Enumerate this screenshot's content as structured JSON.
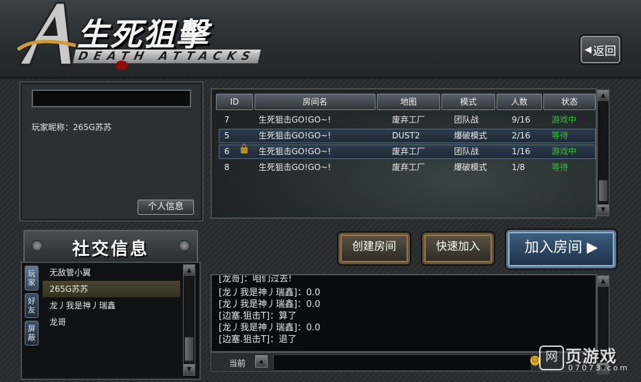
{
  "header": {
    "title": "生死狙擊",
    "subtitle": "DEATH ATTACKS",
    "back_label": "返回",
    "back_arrow": "◀"
  },
  "profile": {
    "player_label": "玩家昵称：265G苏苏",
    "info_button": "个人信息"
  },
  "social": {
    "title": "社交信息",
    "tabs": [
      "玩家",
      "好友",
      "屏蔽"
    ],
    "friends": [
      "无敌管小翼",
      "265G苏苏",
      "龙丿我是神丿瑞鑫",
      "龙哥"
    ],
    "selected_index": 1
  },
  "rooms": {
    "columns": [
      "ID",
      "房间名",
      "地图",
      "模式",
      "人数",
      "状态"
    ],
    "rows": [
      {
        "id": "7",
        "name": "生死狙击GO!GO~!",
        "map": "废弃工厂",
        "mode": "团队战",
        "players": "9/16",
        "status": "游戏中",
        "locked": false,
        "highlight": false,
        "status_color": "#36c23a"
      },
      {
        "id": "5",
        "name": "生死狙击GO!GO~!",
        "map": "DUST2",
        "mode": "爆破模式",
        "players": "2/16",
        "status": "等待",
        "locked": false,
        "highlight": true,
        "status_color": "#36c23a"
      },
      {
        "id": "6",
        "name": "生死狙击GO!GO~!",
        "map": "废弃工厂",
        "mode": "团队战",
        "players": "1/16",
        "status": "游戏中",
        "locked": true,
        "highlight": true,
        "status_color": "#36c23a"
      },
      {
        "id": "8",
        "name": "生死狙击GO!GO~!",
        "map": "废弃工厂",
        "mode": "爆破模式",
        "players": "1/8",
        "status": "等待",
        "locked": false,
        "highlight": false,
        "status_color": "#36c23a"
      }
    ]
  },
  "actions": {
    "create_room": "创建房间",
    "quick_join": "快速加入",
    "join_room": "加入房间 ▶"
  },
  "chat": {
    "lines": [
      "[龙哥]：咱们过去!",
      "[龙丿我是神丿瑞鑫]：0.0",
      "[龙丿我是神丿瑞鑫]：0.0",
      "[边塞.狙击T]：算了",
      "[龙丿我是神丿瑞鑫]：0.0",
      "[边塞.狙击T]：退了"
    ],
    "channel_label": "当前",
    "input_value": ""
  },
  "watermark": {
    "main": "页游戏",
    "sub": "07073.com"
  },
  "colors": {
    "accent_green": "#36c23a",
    "join_blue": "#3e5f80",
    "button_brown": "#5a5142"
  },
  "icons": {
    "scroll_up": "▲",
    "scroll_down": "▼",
    "emoji": "☺"
  }
}
